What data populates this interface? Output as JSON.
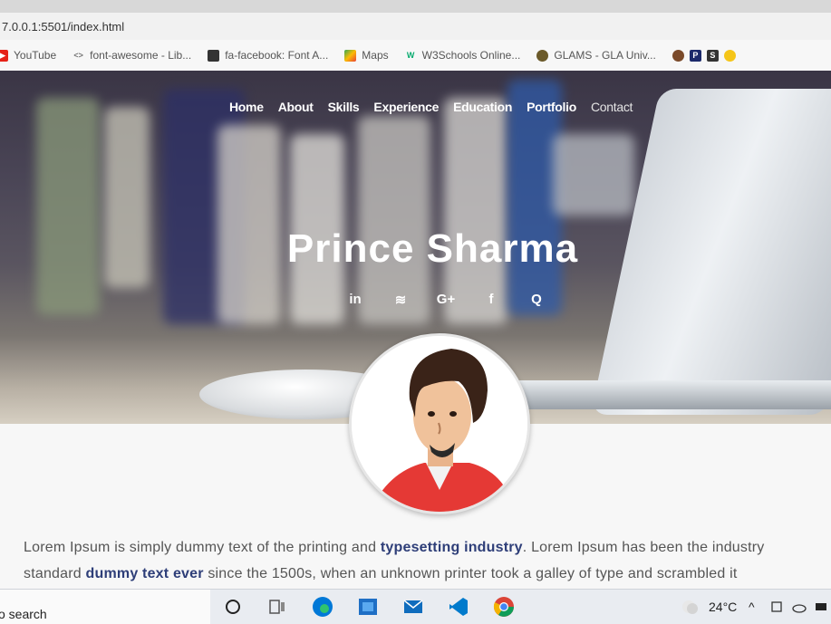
{
  "browser": {
    "url": "7.0.0.1:5501/index.html",
    "bookmarks": [
      {
        "label": "YouTube",
        "icon": "youtube-icon",
        "color": "#e62117"
      },
      {
        "label": "font-awesome - Lib...",
        "icon": "code-icon",
        "color": "#888888"
      },
      {
        "label": "fa-facebook: Font A...",
        "icon": "page-icon",
        "color": "#333333"
      },
      {
        "label": "Maps",
        "icon": "maps-icon",
        "color": "#34a853"
      },
      {
        "label": "W3Schools Online...",
        "icon": "w3schools-icon",
        "color": "#04aa6d"
      },
      {
        "label": "GLAMS - GLA Univ...",
        "icon": "glams-icon",
        "color": "#6b5a2a"
      }
    ]
  },
  "nav": {
    "items": [
      "Home",
      "About",
      "Skills",
      "Experience",
      "Education",
      "Portfolio",
      "Contact"
    ]
  },
  "hero": {
    "name": "Prince Sharma",
    "social_icons": [
      "in",
      "≋",
      "G+",
      "f",
      "Q"
    ],
    "social_names": [
      "linkedin-icon",
      "stack-overflow-icon",
      "google-plus-icon",
      "facebook-icon",
      "quora-icon"
    ]
  },
  "intro": {
    "p1": "Lorem Ipsum is simply dummy text of the printing and ",
    "p1_bold": "typesetting industry",
    "p1_tail": ". Lorem Ipsum has been the industry",
    "p2": "standard ",
    "p2_bold": "dummy text ever",
    "p2_tail": " since the 1500s, when an unknown printer took a galley of type and scrambled it"
  },
  "taskbar": {
    "search_label": "o search",
    "temperature": "24°C"
  },
  "colors": {
    "accent_text": "#2e3e78",
    "avatar_shirt": "#e53935",
    "edge_blue": "#0078d7",
    "vscode_blue": "#007acc"
  }
}
